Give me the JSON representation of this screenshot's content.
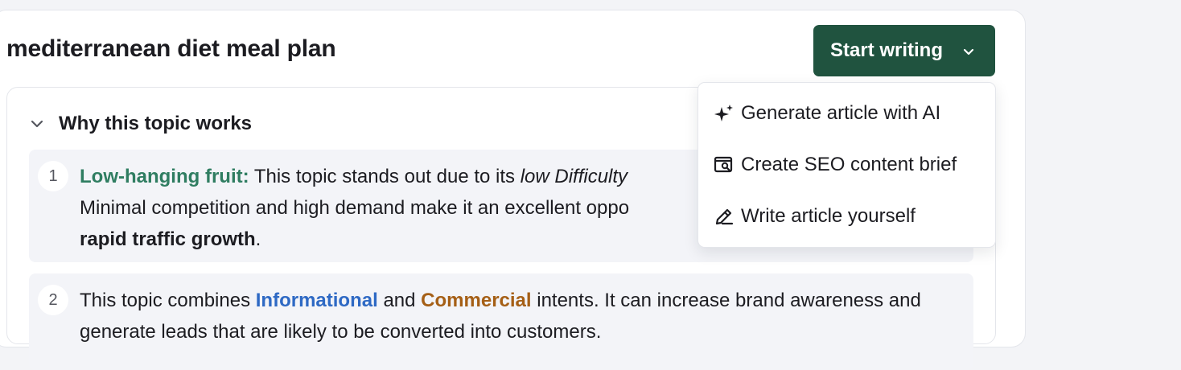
{
  "header": {
    "title": "mediterranean diet meal plan",
    "start_button": {
      "label": "Start writing",
      "icon": "chevron-down-icon"
    }
  },
  "dropdown": {
    "items": [
      {
        "label": "Generate article with AI",
        "icon": "sparkles-icon"
      },
      {
        "label": "Create SEO content brief",
        "icon": "document-search-icon"
      },
      {
        "label": "Write article yourself",
        "icon": "pencil-icon"
      }
    ]
  },
  "section": {
    "title": "Why this topic works",
    "icon": "chevron-down-icon",
    "reasons": [
      {
        "number": "1",
        "lead": "Low-hanging fruit:",
        "text_1": " This topic stands out due to its ",
        "italic_1": "low Difficulty",
        "text_2": " Minimal competition and high demand make it an excellent oppo",
        "bold_end": "rapid traffic growth",
        "text_end": "."
      },
      {
        "number": "2",
        "text_1": "This topic combines ",
        "intent_1": "Informational",
        "text_2": " and ",
        "intent_2": "Commercial",
        "text_3": " intents. It can increase brand awareness and generate leads that are likely to be converted into customers."
      }
    ]
  },
  "colors": {
    "primary": "#20533f",
    "accent_green": "#2f7d61",
    "informational_blue": "#2e69c4",
    "commercial_brown": "#a55f16"
  }
}
